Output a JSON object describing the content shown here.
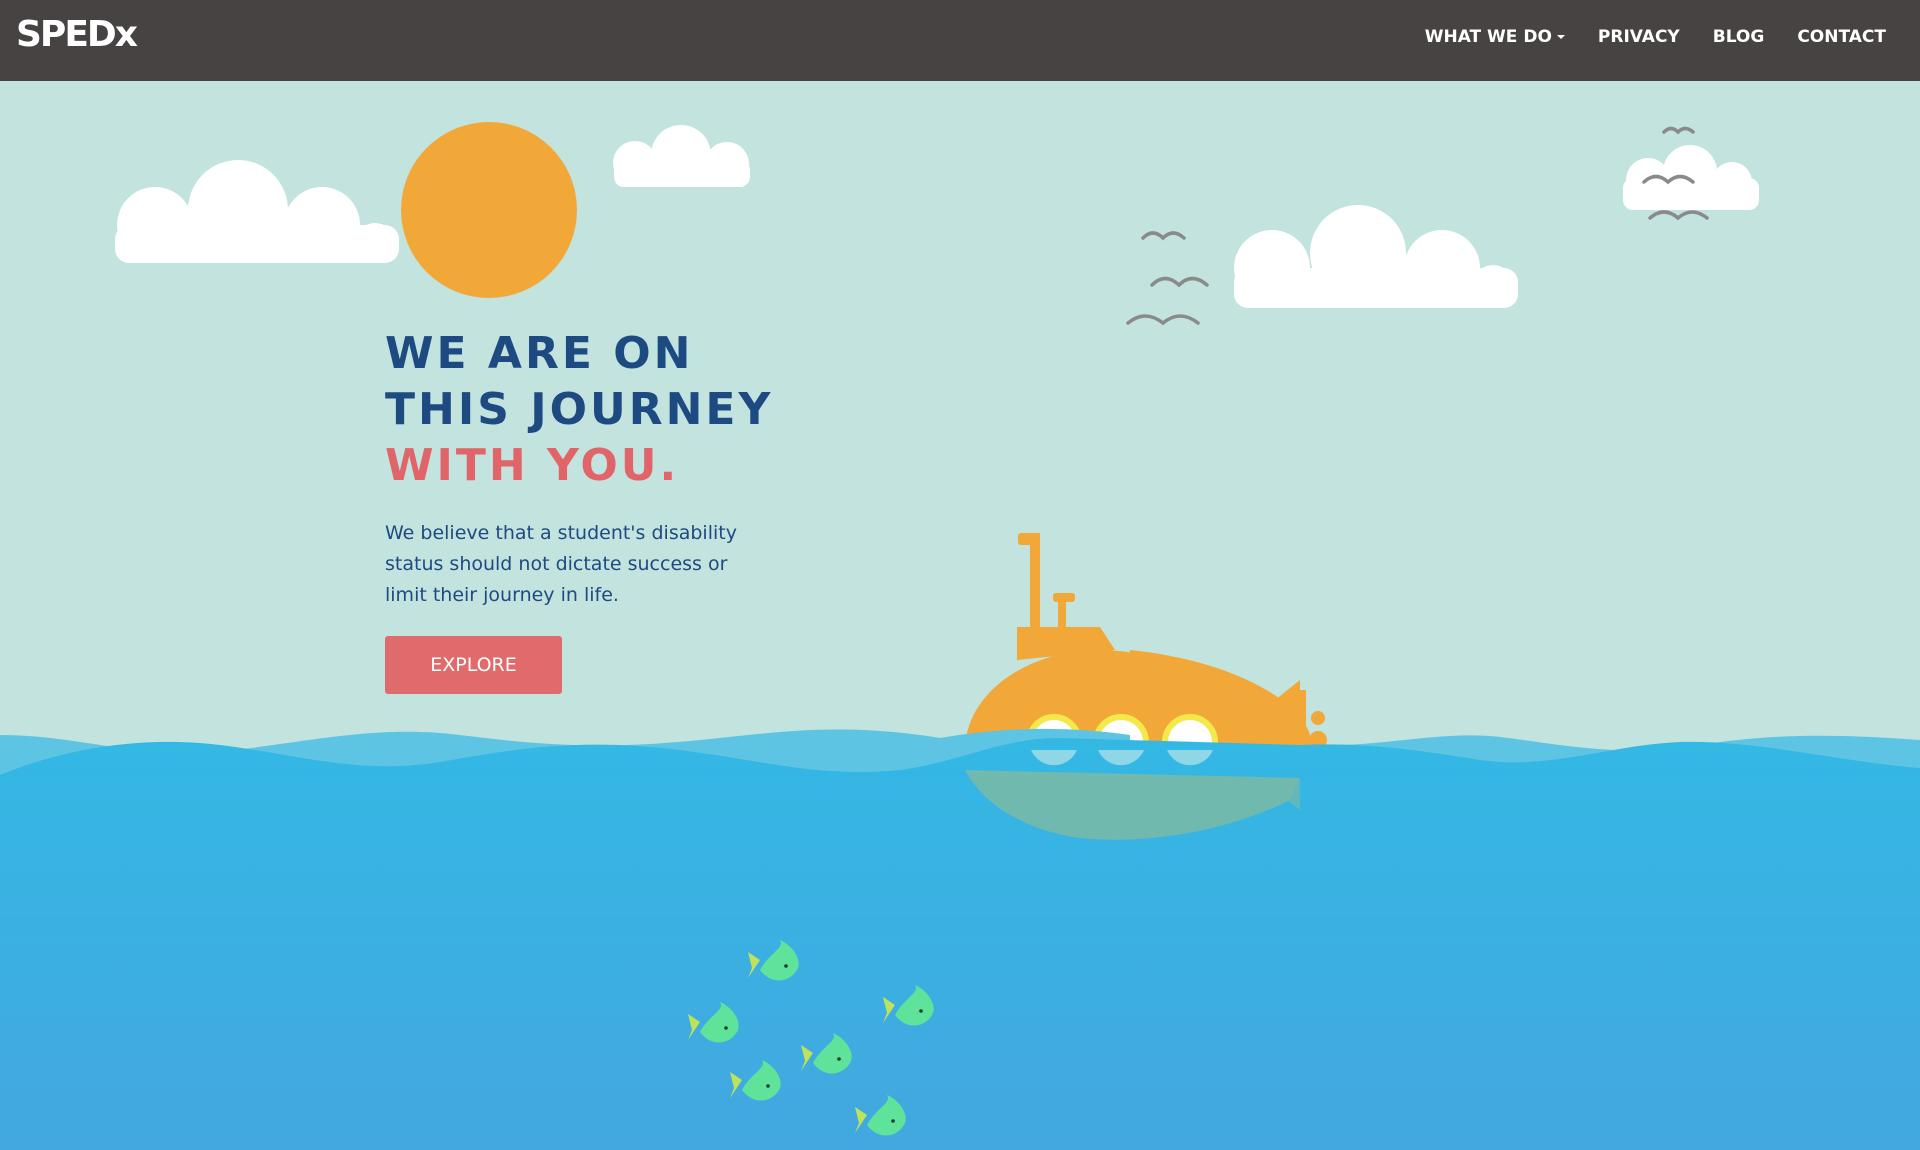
{
  "navbar": {
    "logo": "SPEDx",
    "items": [
      {
        "label": "WHAT WE DO",
        "dropdown": true
      },
      {
        "label": "PRIVACY"
      },
      {
        "label": "BLOG"
      },
      {
        "label": "CONTACT"
      }
    ]
  },
  "hero": {
    "heading_line1": "WE ARE ON",
    "heading_line2": "THIS JOURNEY",
    "heading_line3": "WITH YOU.",
    "description": "We believe that a student's disability status should not dictate success or limit their journey in life.",
    "button_label": "EXPLORE"
  },
  "colors": {
    "sky": "#c2e3de",
    "navbar": "#474343",
    "heading": "#1e4a82",
    "accent": "#e06468",
    "button": "#df6b6d",
    "sun": "#f2a838",
    "submarine": "#f2a838",
    "sea": "#3fa9e2",
    "wave": "#5ec4e4",
    "fish": "#5fe39a"
  }
}
